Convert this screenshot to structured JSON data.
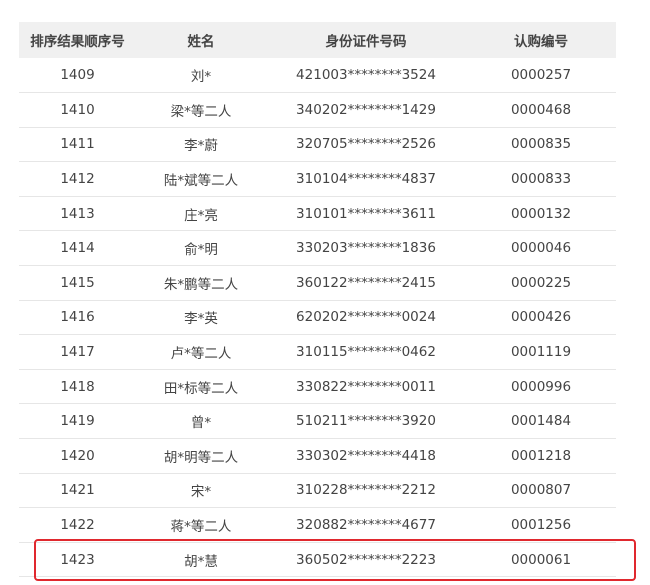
{
  "table": {
    "headers": [
      "排序结果顺序号",
      "姓名",
      "身份证件号码",
      "认购编号"
    ],
    "rows": [
      [
        "1409",
        "刘*",
        "421003********3524",
        "0000257"
      ],
      [
        "1410",
        "梁*等二人",
        "340202********1429",
        "0000468"
      ],
      [
        "1411",
        "李*蔚",
        "320705********2526",
        "0000835"
      ],
      [
        "1412",
        "陆*斌等二人",
        "310104********4837",
        "0000833"
      ],
      [
        "1413",
        "庄*亮",
        "310101********3611",
        "0000132"
      ],
      [
        "1414",
        "俞*明",
        "330203********1836",
        "0000046"
      ],
      [
        "1415",
        "朱*鹏等二人",
        "360122********2415",
        "0000225"
      ],
      [
        "1416",
        "李*英",
        "620202********0024",
        "0000426"
      ],
      [
        "1417",
        "卢*等二人",
        "310115********0462",
        "0001119"
      ],
      [
        "1418",
        "田*标等二人",
        "330822********0011",
        "0000996"
      ],
      [
        "1419",
        "曾*",
        "510211********3920",
        "0001484"
      ],
      [
        "1420",
        "胡*明等二人",
        "330302********4418",
        "0001218"
      ],
      [
        "1421",
        "宋*",
        "310228********2212",
        "0000807"
      ],
      [
        "1422",
        "蒋*等二人",
        "320882********4677",
        "0001256"
      ],
      [
        "1423",
        "胡*慧",
        "360502********2223",
        "0000061"
      ]
    ]
  },
  "highlight": {
    "row_number": "1423",
    "color": "#e0282e"
  },
  "colors": {
    "header_bg": "#f0f0f0",
    "text": "#444444",
    "row_border": "#e6e6e6"
  }
}
